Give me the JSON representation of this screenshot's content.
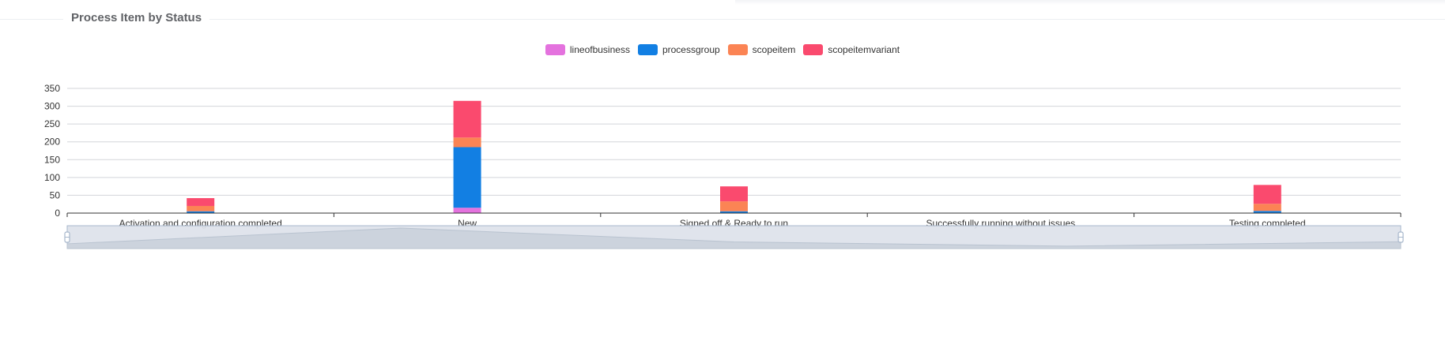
{
  "section": {
    "title": "Process Item by Status"
  },
  "colors": {
    "lineofbusiness": "#e472de",
    "processgroup": "#127fe3",
    "scopeitem": "#fb8454",
    "scopeitemvariant": "#fa4a6e",
    "grid": "#d3d5da",
    "axis": "#333333",
    "zoom_fill": "#dde2ea",
    "zoom_shadow": "#c8d0da",
    "zoom_handle": "#a7b7cc"
  },
  "chart_data": {
    "type": "bar",
    "stacked": true,
    "categories": [
      "Activation and configuration completed",
      "New",
      "Signed off & Ready to run",
      "Successfully running without issues",
      "Testing completed"
    ],
    "series": [
      {
        "name": "lineofbusiness",
        "values": [
          0,
          15,
          0,
          0,
          0
        ]
      },
      {
        "name": "processgroup",
        "values": [
          5,
          170,
          5,
          0,
          6
        ]
      },
      {
        "name": "scopeitem",
        "values": [
          15,
          27,
          28,
          0,
          20
        ]
      },
      {
        "name": "scopeitemvariant",
        "values": [
          22,
          103,
          42,
          1,
          53
        ]
      }
    ],
    "yticks": [
      0,
      50,
      100,
      150,
      200,
      250,
      300,
      350
    ],
    "ylim": [
      0,
      350
    ],
    "grid": true,
    "legend_position": "top-center",
    "data_zoom": true
  }
}
